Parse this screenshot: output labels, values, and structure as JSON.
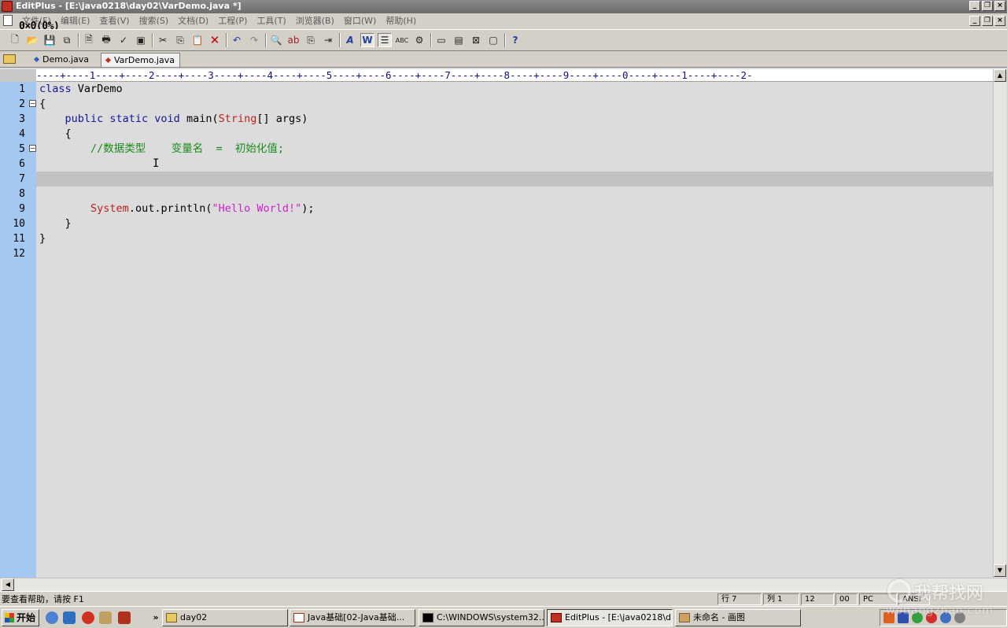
{
  "window": {
    "title": "EditPlus - [E:\\java0218\\day02\\VarDemo.java *]"
  },
  "overlay": {
    "text": "0×0(0%)"
  },
  "menu": {
    "items": [
      "文件(F)",
      "编辑(E)",
      "查看(V)",
      "搜索(S)",
      "文档(D)",
      "工程(P)",
      "工具(T)",
      "浏览器(B)",
      "窗口(W)",
      "帮助(H)"
    ]
  },
  "toolbar": {
    "icons": [
      "new-file-icon",
      "open-folder-icon",
      "save-icon",
      "save-all-icon",
      "print-preview-icon",
      "print-icon",
      "spell-check-icon",
      "html-preview-icon",
      "cut-icon",
      "copy-icon",
      "paste-icon",
      "delete-icon",
      "undo-icon",
      "redo-icon",
      "find-icon",
      "replace-icon",
      "find-in-files-icon",
      "goto-line-icon",
      "font-icon",
      "word-wrap-icon",
      "line-numbers-icon",
      "ruler-icon",
      "customize-icon",
      "window-cascade-icon",
      "window-tile-icon",
      "window-close-icon",
      "fullscreen-icon",
      "help-icon"
    ]
  },
  "tabs": [
    {
      "label": "Demo.java",
      "active": false
    },
    {
      "label": "VarDemo.java",
      "active": true
    }
  ],
  "editor": {
    "ruler": "----+----1----+----2----+----3----+----4----+----5----+----6----+----7----+----8----+----9----+----0----+----1----+----2-",
    "line_numbers": [
      "1",
      "2",
      "3",
      "4",
      "5",
      "6",
      "7",
      "8",
      "9",
      "10",
      "11",
      "12"
    ],
    "current_line": 7,
    "code": {
      "l1_kw": "class",
      "l1_rest": " VarDemo",
      "l2": "{",
      "l3_indent": "    ",
      "l3_kw": "public static void",
      "l3_mid": " main(",
      "l3_type": "String",
      "l3_rest": "[] args)",
      "l4": "    {",
      "l5_indent": "        ",
      "l5_comment": "//数据类型    变量名  =  初始化值;",
      "l9_indent": "        ",
      "l9_type": "System",
      "l9_mid": ".out.println(",
      "l9_str": "\"Hello World!\"",
      "l9_rest": ");",
      "l10": "    }",
      "l11": "}"
    },
    "caret": "I"
  },
  "statusbar": {
    "help": "要查看帮助，请按 F1",
    "row": "行 7",
    "col": "列 1",
    "lines": "12",
    "extra": "00",
    "mode": "PC",
    "encoding": "ANSI"
  },
  "taskbar": {
    "start": "开始",
    "more": "»",
    "buttons": [
      {
        "label": "day02"
      },
      {
        "label": "Java基础[02-Java基础..."
      },
      {
        "label": "C:\\WINDOWS\\system32..."
      },
      {
        "label": "EditPlus - [E:\\java0218\\d..."
      },
      {
        "label": "未命名 - 画图"
      }
    ]
  },
  "watermark": {
    "cn": "我帮找网",
    "en": "wobangzhao.com"
  },
  "colors": {
    "keyword": "#1414a0",
    "type": "#c02020",
    "comment": "#1a8a1a",
    "string": "#d020d0",
    "gutter": "#a4c8f0"
  }
}
